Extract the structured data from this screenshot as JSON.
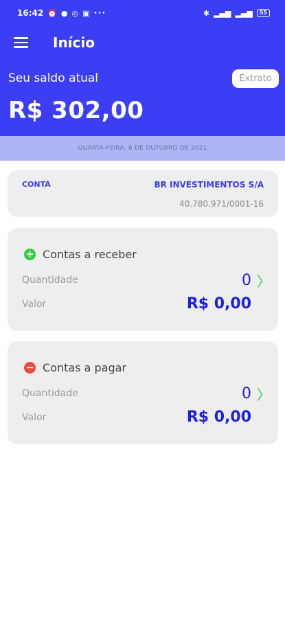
{
  "status_bar": {
    "time": "16:42",
    "notif_icons": [
      "alarm-icon",
      "messenger-icon",
      "whatsapp-icon",
      "notes-icon"
    ],
    "more": "···",
    "battery": "55"
  },
  "appbar": {
    "title": "Início"
  },
  "balance": {
    "label": "Seu saldo atual",
    "value": "R$ 302,00",
    "extrato_label": "Extrato"
  },
  "date_text": "QUARTA-FEIRA, 6 DE OUTUBRO DE 2021",
  "account": {
    "label": "CONTA",
    "company": "BR INVESTIMENTOS S/A",
    "cnpj": "40.780.971/0001-16"
  },
  "receivable": {
    "title": "Contas a receber",
    "qty_label": "Quantidade",
    "qty_value": "0",
    "value_label": "Valor",
    "value": "R$ 0,00"
  },
  "payable": {
    "title": "Contas a pagar",
    "qty_label": "Quantidade",
    "qty_value": "0",
    "value_label": "Valor",
    "value": "R$ 0,00"
  },
  "colors": {
    "primary": "#3b3ef5",
    "date_strip": "#aeb4f6",
    "card_bg": "#eeeeee",
    "positive": "#2ecc40",
    "negative": "#e74c3c"
  }
}
